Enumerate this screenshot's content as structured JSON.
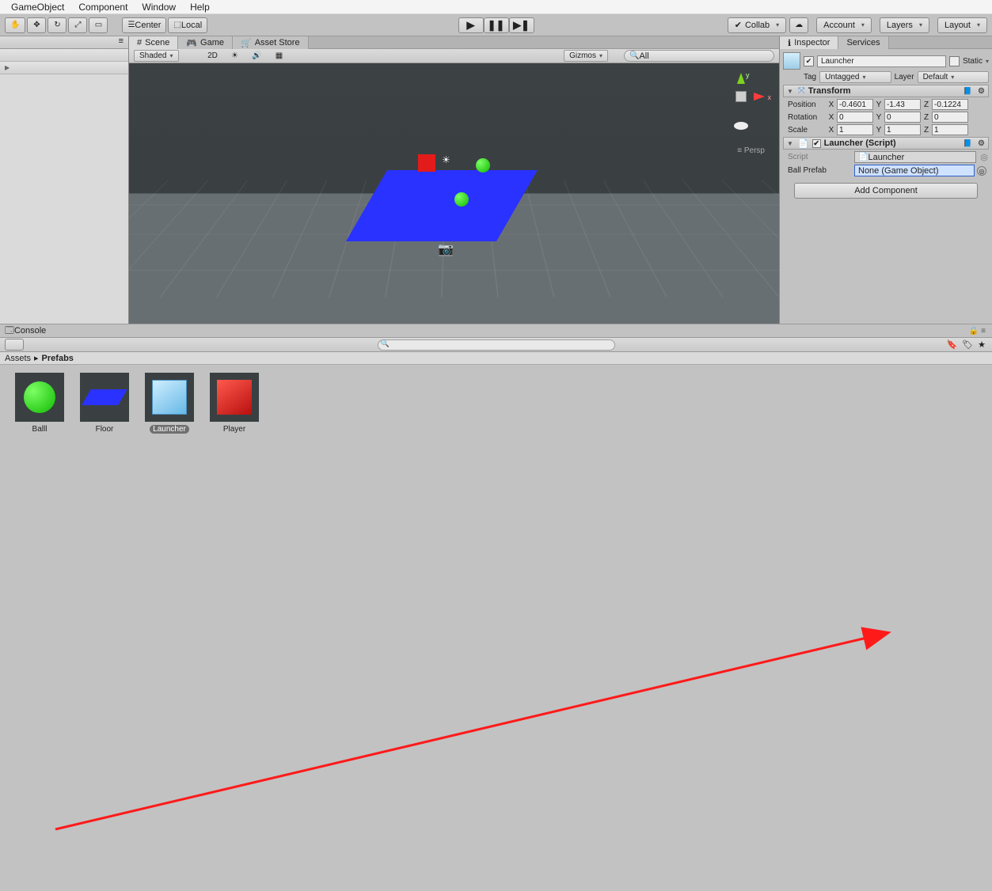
{
  "menu": {
    "gameobject": "GameObject",
    "component": "Component",
    "window": "Window",
    "help": "Help"
  },
  "toolbar": {
    "center": "Center",
    "local": "Local",
    "collab": "Collab",
    "account": "Account",
    "layers": "Layers",
    "layout": "Layout"
  },
  "sceneTabs": {
    "scene": "Scene",
    "game": "Game",
    "assetStore": "Asset Store"
  },
  "sceneOpts": {
    "shaded": "Shaded",
    "twoD": "2D",
    "gizmos": "Gizmos",
    "search": "All"
  },
  "sceneOverlay": {
    "persp": "Persp"
  },
  "inspectorTab": {
    "inspector": "Inspector",
    "services": "Services"
  },
  "inspector": {
    "name": "Launcher",
    "static": "Static",
    "tag": "Tag",
    "tagVal": "Untagged",
    "layer": "Layer",
    "layerVal": "Default",
    "transform": "Transform",
    "position": "Position",
    "rotation": "Rotation",
    "scale": "Scale",
    "px": "-0.4601",
    "py": "-1.43",
    "pz": "-0.1224",
    "rx": "0",
    "ry": "0",
    "rz": "0",
    "sx": "1",
    "sy": "1",
    "sz": "1",
    "scriptComp": "Launcher (Script)",
    "scriptLabel": "Script",
    "scriptVal": "Launcher",
    "ballPrefab": "Ball Prefab",
    "ballPrefabVal": "None (Game Object)",
    "addComponent": "Add Component"
  },
  "console": {
    "label": "Console"
  },
  "project": {
    "breadcrumb1": "Assets",
    "breadcrumb2": "Prefabs",
    "assets": [
      "Balll",
      "Floor",
      "Launcher",
      "Player"
    ]
  }
}
